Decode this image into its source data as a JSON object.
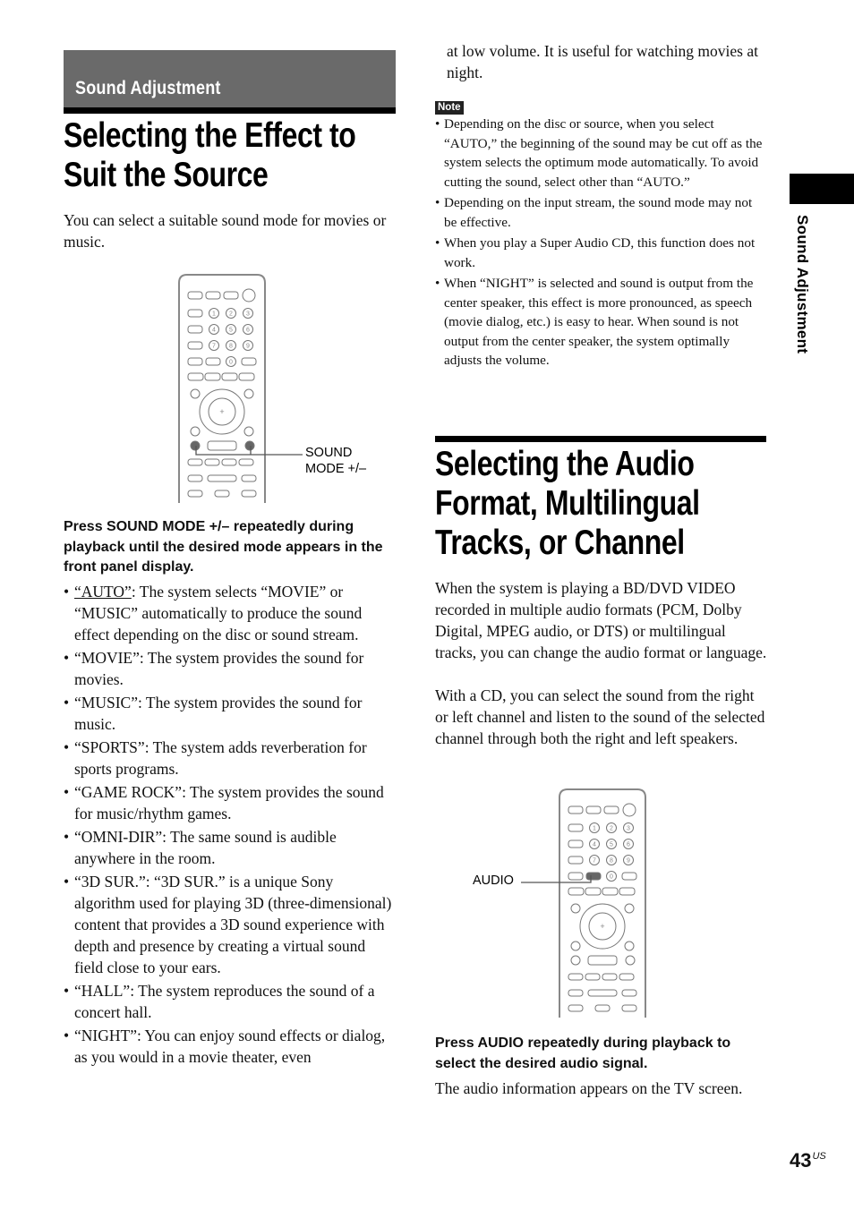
{
  "section_header": "Sound Adjustment",
  "side_tab": "Sound Adjustment",
  "page_number": "43",
  "page_suffix": "US",
  "section1": {
    "title_line1": "Selecting the Effect to",
    "title_line2": "Suit the Source",
    "intro": "You can select a suitable sound mode for movies or music.",
    "figure_callout_line1": "SOUND",
    "figure_callout_line2": "MODE +/–",
    "step": "Press SOUND MODE +/– repeatedly during playback until the desired mode appears in the front panel display.",
    "modes": [
      {
        "name": "“AUTO”",
        "desc": ": The system selects “MOVIE” or “MUSIC” automatically to produce the sound effect depending on the disc or sound stream."
      },
      {
        "name": "“MOVIE”",
        "desc": ": The system provides the sound for movies."
      },
      {
        "name": "“MUSIC”",
        "desc": ": The system provides the sound for music."
      },
      {
        "name": "“SPORTS”",
        "desc": ": The system adds reverberation for sports programs."
      },
      {
        "name": "“GAME ROCK”",
        "desc": ": The system provides the sound for music/rhythm games."
      },
      {
        "name": "“OMNI-DIR”",
        "desc": ": The same sound is audible anywhere in the room."
      },
      {
        "name": "“3D SUR.”",
        "desc": ": “3D SUR.” is a unique Sony algorithm used for playing 3D (three-dimensional) content that provides a 3D sound experience with depth and presence by creating a virtual sound field close to your ears."
      },
      {
        "name": "“HALL”",
        "desc": ": The system reproduces the sound of a concert hall."
      },
      {
        "name": "“NIGHT”",
        "desc": ": You can enjoy sound effects or dialog, as you would in a movie theater, even"
      }
    ],
    "night_continued": "at low volume. It is useful for watching movies at night.",
    "note_label": "Note",
    "notes": [
      "Depending on the disc or source, when you select “AUTO,” the beginning of the sound may be cut off as the system selects the optimum mode automatically. To avoid cutting the sound, select other than “AUTO.”",
      "Depending on the input stream, the sound mode may not be effective.",
      "When you play a Super Audio CD, this function does not work.",
      "When “NIGHT” is selected and sound is output from the center speaker, this effect is more pronounced, as speech (movie dialog, etc.) is easy to hear. When sound is not output from the center speaker, the system optimally adjusts the volume."
    ]
  },
  "section2": {
    "title_line1": "Selecting the Audio",
    "title_line2": "Format, Multilingual",
    "title_line3": "Tracks, or Channel",
    "para1": "When the system is playing a BD/DVD VIDEO recorded in multiple audio formats (PCM, Dolby Digital, MPEG audio, or DTS) or multilingual tracks, you can change the audio format or language.",
    "para2": "With a CD, you can select the sound from the right or left channel and listen to the sound of the selected channel through both the right and left speakers.",
    "figure_callout": "AUDIO",
    "step": "Press AUDIO repeatedly during playback to select the desired audio signal.",
    "result": "The audio information appears on the TV screen."
  },
  "remote_keys": {
    "row1": [
      "",
      "",
      ""
    ],
    "numbers": [
      "1",
      "2",
      "3",
      "4",
      "5",
      "6",
      "7",
      "8",
      "9",
      "0"
    ]
  }
}
